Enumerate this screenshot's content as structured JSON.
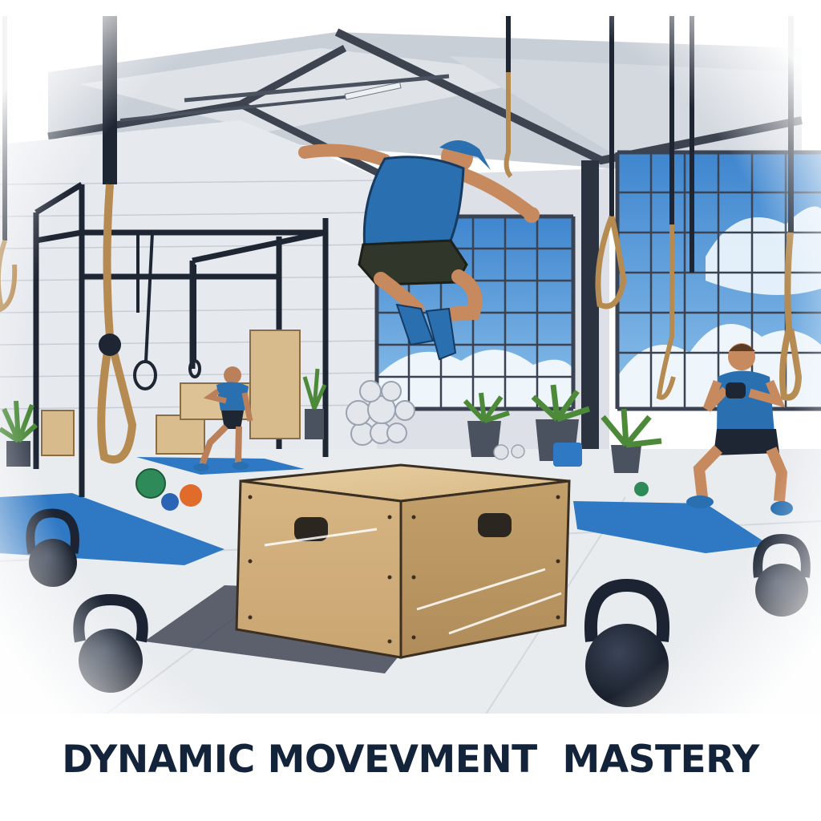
{
  "caption": {
    "text": "DYNAMIC MOVEVMENT  MASTERY"
  },
  "palette": {
    "ink": "#13233a",
    "accent_blue": "#2a6fb0",
    "mat_blue": "#2e78c4",
    "wood": "#d8bb8c",
    "kettlebell": "#1c2433",
    "sky": "#5b9bd5",
    "floor": "#e9ecef"
  },
  "scene": {
    "subject": "athlete-box-jump",
    "setting": "industrial-gym",
    "elements": [
      "plyo-box",
      "kettlebell",
      "climbing-rope",
      "pull-up-rig",
      "gym-mat",
      "medicine-ball",
      "potted-plant",
      "window"
    ]
  }
}
